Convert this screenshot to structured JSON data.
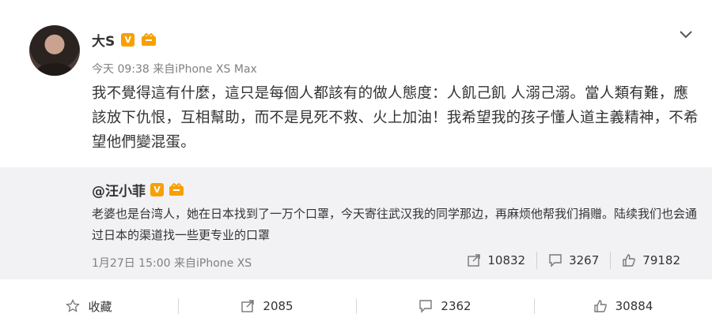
{
  "post": {
    "username": "大S",
    "verified_badge": "V",
    "timestamp": "今天 09:38",
    "source": "来自iPhone XS Max",
    "text": "我不覺得這有什麼，這只是每個人都該有的做人態度：人飢己飢 人溺己溺。當人類有難，應該放下仇恨，互相幫助，而不是見死不救、火上加油！我希望我的孩子懂人道主義精神，不希望他們變混蛋。"
  },
  "repost": {
    "username": "@汪小菲",
    "verified_badge": "V",
    "text": "老婆也是台湾人，她在日本找到了一万个口罩，今天寄往武汉我的同学那边，再麻烦他帮我们捐赠。陆续我们也会通过日本的渠道找一些更专业的口罩",
    "timestamp": "1月27日 15:00",
    "source": "来自iPhone XS",
    "stats": {
      "reposts": "10832",
      "comments": "3267",
      "likes": "79182"
    }
  },
  "footer": {
    "favorite_label": "收藏",
    "reposts": "2085",
    "comments": "2362",
    "likes": "30884"
  },
  "colors": {
    "accent_badge": "#f7a000",
    "repost_bg": "#f2f2f5",
    "meta_text": "#808080"
  },
  "icons": [
    "chevron-down-icon",
    "verified-icon",
    "member-icon",
    "star-icon",
    "repost-icon",
    "comment-icon",
    "like-icon"
  ]
}
